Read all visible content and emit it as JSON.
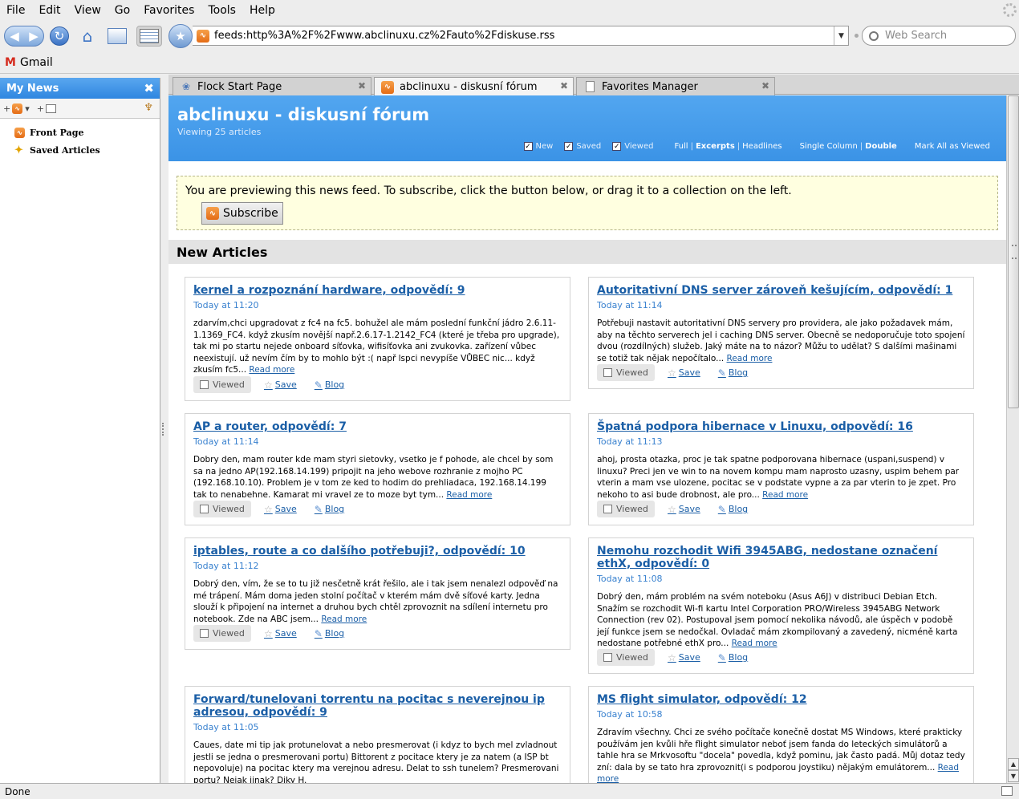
{
  "menu": [
    "File",
    "Edit",
    "View",
    "Go",
    "Favorites",
    "Tools",
    "Help"
  ],
  "url": "feeds:http%3A%2F%2Fwww.abclinuxu.cz%2Fauto%2Fdiskuse.rss",
  "search_placeholder": "Web Search",
  "bookmarks": [
    {
      "label": "Gmail"
    }
  ],
  "sidebar": {
    "title": "My News",
    "items": [
      {
        "label": "Front Page"
      },
      {
        "label": "Saved Articles"
      }
    ]
  },
  "tabs": [
    {
      "label": "Flock Start Page",
      "active": false
    },
    {
      "label": "abclinuxu - diskusní fórum",
      "active": true
    },
    {
      "label": "Favorites Manager",
      "active": false
    }
  ],
  "feed": {
    "title": "abclinuxu - diskusní fórum",
    "subtitle": "Viewing 25 articles",
    "filters": [
      "New",
      "Saved",
      "Viewed"
    ],
    "view": {
      "full": "Full",
      "excerpts": "Excerpts",
      "headlines": "Headlines"
    },
    "columns": {
      "single": "Single Column",
      "double": "Double"
    },
    "mark_all": "Mark All as Viewed",
    "separator": "|",
    "preview_text": "You are previewing this news feed. To subscribe, click the button below, or drag it to a collection on the left.",
    "subscribe_label": "Subscribe",
    "section_heading": "New Articles"
  },
  "actions": {
    "viewed": "Viewed",
    "save": "Save",
    "blog": "Blog",
    "read_more": "Read more"
  },
  "articles": [
    {
      "title": "kernel a rozpoznání hardware, odpovědí: 9",
      "time": "Today at 11:20",
      "text": "zdarvím,chci upgradovat z fc4 na fc5. bohužel ale mám poslední funkční jádro 2.6.11-1.1369_FC4. když zkusím novější např.2.6.17-1.2142_FC4 (které je třeba pro upgrade), tak mi po startu nejede onboard síťovka, wifisíťovka ani zvukovka. zařízení vůbec neexistují. už nevím čím by to mohlo být :( např lspci nevypíše VŮBEC nic... když zkusím fc5..."
    },
    {
      "title": "Autoritativní DNS server zároveň kešujícím, odpovědí: 1",
      "time": "Today at 11:14",
      "text": "Potřebuji nastavit autoritativní DNS servery pro providera, ale jako požadavek mám, aby na těchto serverech jel i caching DNS server. Obecně se nedoporučuje toto spojení dvou (rozdílných) služeb. Jaký máte na to názor? Můžu to udělat? S dalšími mašinami se totiž tak nějak nepočítalo..."
    },
    {
      "title": "AP a router, odpovědí: 7",
      "time": "Today at 11:14",
      "text": "Dobry den, mam router kde mam styri sietovky, vsetko je f pohode, ale chcel by som sa na jedno AP(192.168.14.199) pripojit na jeho webove rozhranie z mojho PC (192.168.10.10). Problem je v tom ze ked to hodim do prehliadaca, 192.168.14.199 tak to nenabehne. Kamarat mi vravel ze to moze byt tym..."
    },
    {
      "title": "Špatná podpora hibernace v Linuxu, odpovědí: 16",
      "time": "Today at 11:13",
      "text": "ahoj, prosta otazka, proc je tak spatne podporovana hibernace (uspani,suspend) v linuxu? Preci jen ve win to na novem kompu mam naprosto uzasny, uspim behem par vterin a mam vse ulozene, pocitac se v podstate vypne a za par vterin to je zpet. Pro nekoho to asi bude drobnost, ale pro..."
    },
    {
      "title": "iptables, route a co dalšího potřebuji?, odpovědí: 10",
      "time": "Today at 11:12",
      "text": "Dobrý den, vím, že se to tu již nesčetně krát řešilo, ale i tak jsem nenalezl odpověď na mé trápení. Mám doma jeden stolní počítač v kterém mám dvě síťové karty. Jedna slouží k připojení na internet a druhou bych chtěl zprovoznit na sdílení internetu pro notebook. Zde na ABC jsem..."
    },
    {
      "title": "Nemohu rozchodit Wifi 3945ABG, nedostane označení ethX, odpovědí: 0",
      "time": "Today at 11:08",
      "text": "Dobrý den, mám problém na svém noteboku (Asus A6J) v distribuci Debian Etch. Snažím se rozchodit Wi-fi kartu Intel Corporation PRO/Wireless 3945ABG Network Connection (rev 02). Postupoval jsem pomocí nekolika návodů, ale úspěch v podobě její funkce jsem se nedočkal. Ovladač mám zkompilovaný a zavedený, nicméně karta nedostane potřebné ethX pro..."
    },
    {
      "title": "Forward/tunelovani torrentu na pocitac s neverejnou ip adresou, odpovědí: 9",
      "time": "Today at 11:05",
      "text": "Caues, date mi tip jak protunelovat a nebo presmerovat (i kdyz to bych mel zvladnout jestli se jedna o presmerovani portu) Bittorent z pocitace ktery je za natem (a ISP bt nepovoluje) na pocitac ktery ma verejnou adresu. Delat to ssh tunelem? Presmerovani portu? Nejak jinak? Diky H."
    },
    {
      "title": "MS flight simulator, odpovědí: 12",
      "time": "Today at 10:58",
      "text": "Zdravím všechny. Chci ze svého počítače konečně dostat MS Windows, které prakticky používám jen kvůli hře flight simulator neboť jsem fanda do leteckých simulátorů a tahle hra se Mrkvosoftu \"docela\" povedla, když pominu, jak často padá. Můj dotaz tedy zní: dala by se tato hra zprovoznit(i s podporou joystiku) nějakým emulátorem..."
    }
  ],
  "status": "Done"
}
